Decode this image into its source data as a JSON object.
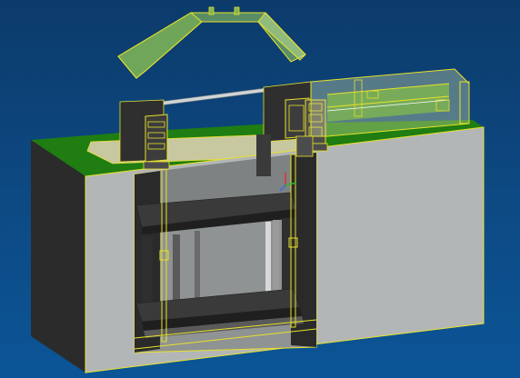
{
  "viewport": {
    "background_top": "#0c3b6b",
    "background_bottom": "#0b5597"
  },
  "colors": {
    "grass_top": "#1f7d12",
    "grass_dark": "#145b0c",
    "wall_front": "#b3b6b6",
    "wall_side": "#2b2b2b",
    "wall_edge": "#d8d23a",
    "selection_yellow": "#e8e22a",
    "canopy_fill": "#9ad060",
    "machinery_dark": "#2f2f2f",
    "machinery_mid": "#4c4c4c",
    "interior": "#8f9393",
    "glass": "#dfe6a8"
  },
  "icons": {
    "axis_triad": "axis-triad-icon"
  }
}
